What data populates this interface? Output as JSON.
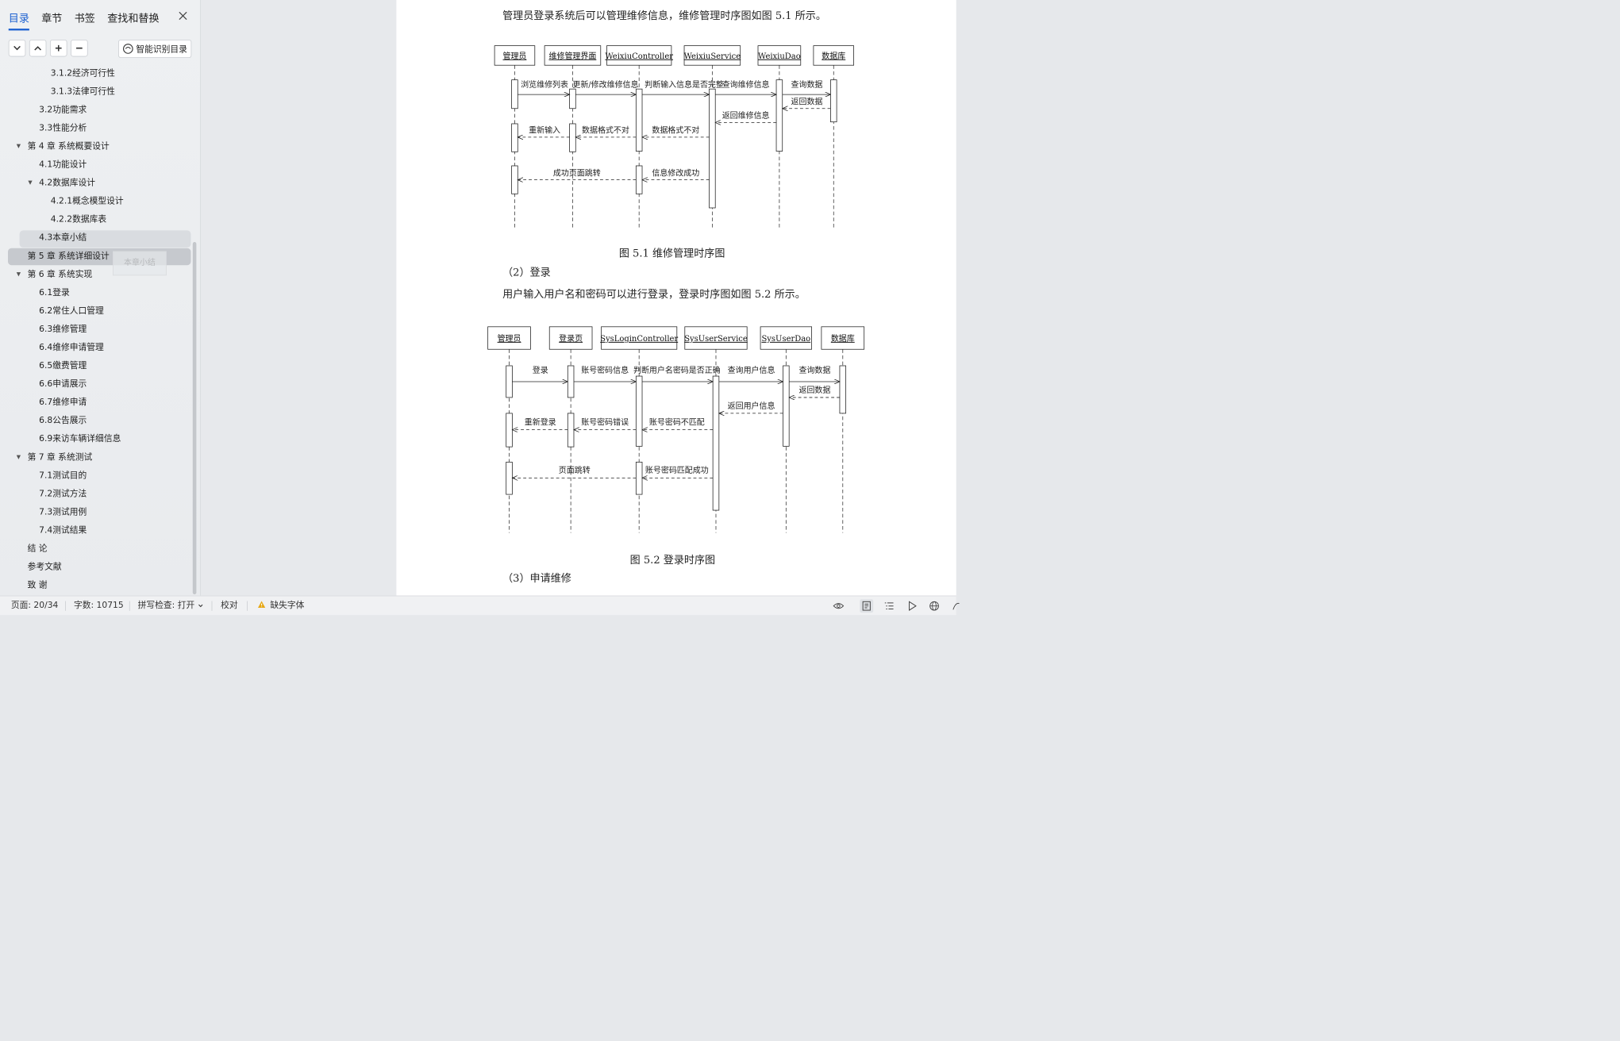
{
  "sidebar": {
    "tabs": [
      {
        "label": "目录",
        "active": true
      },
      {
        "label": "章节",
        "active": false
      },
      {
        "label": "书签",
        "active": false
      },
      {
        "label": "查找和替换",
        "active": false
      }
    ],
    "ai_toc_label": "智能识别目录",
    "drag_ghost_label": "本章小结",
    "toc": [
      {
        "label": "3.1.2经济可行性",
        "level": 3
      },
      {
        "label": "3.1.3法律可行性",
        "level": 3
      },
      {
        "label": "3.2功能需求",
        "level": 2
      },
      {
        "label": "3.3性能分析",
        "level": 2
      },
      {
        "label": "第 4 章  系统概要设计",
        "level": 1,
        "expanded": true
      },
      {
        "label": "4.1功能设计",
        "level": 2
      },
      {
        "label": "4.2数据库设计",
        "level": 2,
        "expanded": true
      },
      {
        "label": "4.2.1概念模型设计",
        "level": 3
      },
      {
        "label": "4.2.2数据库表",
        "level": 3
      },
      {
        "label": "4.3本章小结",
        "level": 2,
        "hover": true
      },
      {
        "label": "第 5 章  系统详细设计",
        "level": 1,
        "selected": true
      },
      {
        "label": "第 6 章  系统实现",
        "level": 1,
        "expanded": true
      },
      {
        "label": "6.1登录",
        "level": 2
      },
      {
        "label": "6.2常住人口管理",
        "level": 2
      },
      {
        "label": "6.3维修管理",
        "level": 2
      },
      {
        "label": "6.4维修申请管理",
        "level": 2
      },
      {
        "label": "6.5缴费管理",
        "level": 2
      },
      {
        "label": "6.6申请展示",
        "level": 2
      },
      {
        "label": "6.7维修申请",
        "level": 2
      },
      {
        "label": "6.8公告展示",
        "level": 2
      },
      {
        "label": "6.9来访车辆详细信息",
        "level": 2
      },
      {
        "label": "第 7 章  系统测试",
        "level": 1,
        "expanded": true
      },
      {
        "label": "7.1测试目的",
        "level": 2
      },
      {
        "label": "7.2测试方法",
        "level": 2
      },
      {
        "label": "7.3测试用例",
        "level": 2
      },
      {
        "label": "7.4测试结果",
        "level": 2
      },
      {
        "label": "结    论",
        "level": 1
      },
      {
        "label": "参考文献",
        "level": 1
      },
      {
        "label": "致    谢",
        "level": 1
      }
    ]
  },
  "document": {
    "para1": "管理员登录系统后可以管理维修信息，维修管理时序图如图 5.1 所示。",
    "fig1": {
      "caption": "图 5.1  维修管理时序图",
      "lifelines": [
        "管理员",
        "维修管理界面",
        "WeixiuController",
        "WeixiuService",
        "WeixiuDao",
        "数据库"
      ],
      "messages": [
        "浏览维修列表",
        "更新/修改维修信息",
        "判断输入信息是否完整",
        "查询维修信息",
        "查询数据",
        "返回数据",
        "返回维修信息",
        "重新输入",
        "数据格式不对",
        "数据格式不对",
        "成功页面跳转",
        "信息修改成功"
      ]
    },
    "heading2": "（2）登录",
    "para2": "用户输入用户名和密码可以进行登录，登录时序图如图 5.2 所示。",
    "fig2": {
      "caption": "图 5.2  登录时序图",
      "lifelines": [
        "管理员",
        "登录页",
        "SysLoginController",
        "SysUserService",
        "SysUserDao",
        "数据库"
      ],
      "messages": [
        "登录",
        "账号密码信息",
        "判断用户名密码是否正确",
        "查询用户信息",
        "查询数据",
        "返回数据",
        "返回用户信息",
        "重新登录",
        "账号密码错误",
        "账号密码不匹配",
        "页面跳转",
        "账号密码匹配成功"
      ]
    },
    "heading3": "（3）申请维修"
  },
  "status": {
    "page": "页面: 20/34",
    "words": "字数: 10715",
    "spell": "拼写检查: 打开",
    "proof": "校对",
    "missing_font": "缺失字体"
  },
  "colors": {
    "accent": "#1a5fd0",
    "warning": "#e6a817"
  }
}
